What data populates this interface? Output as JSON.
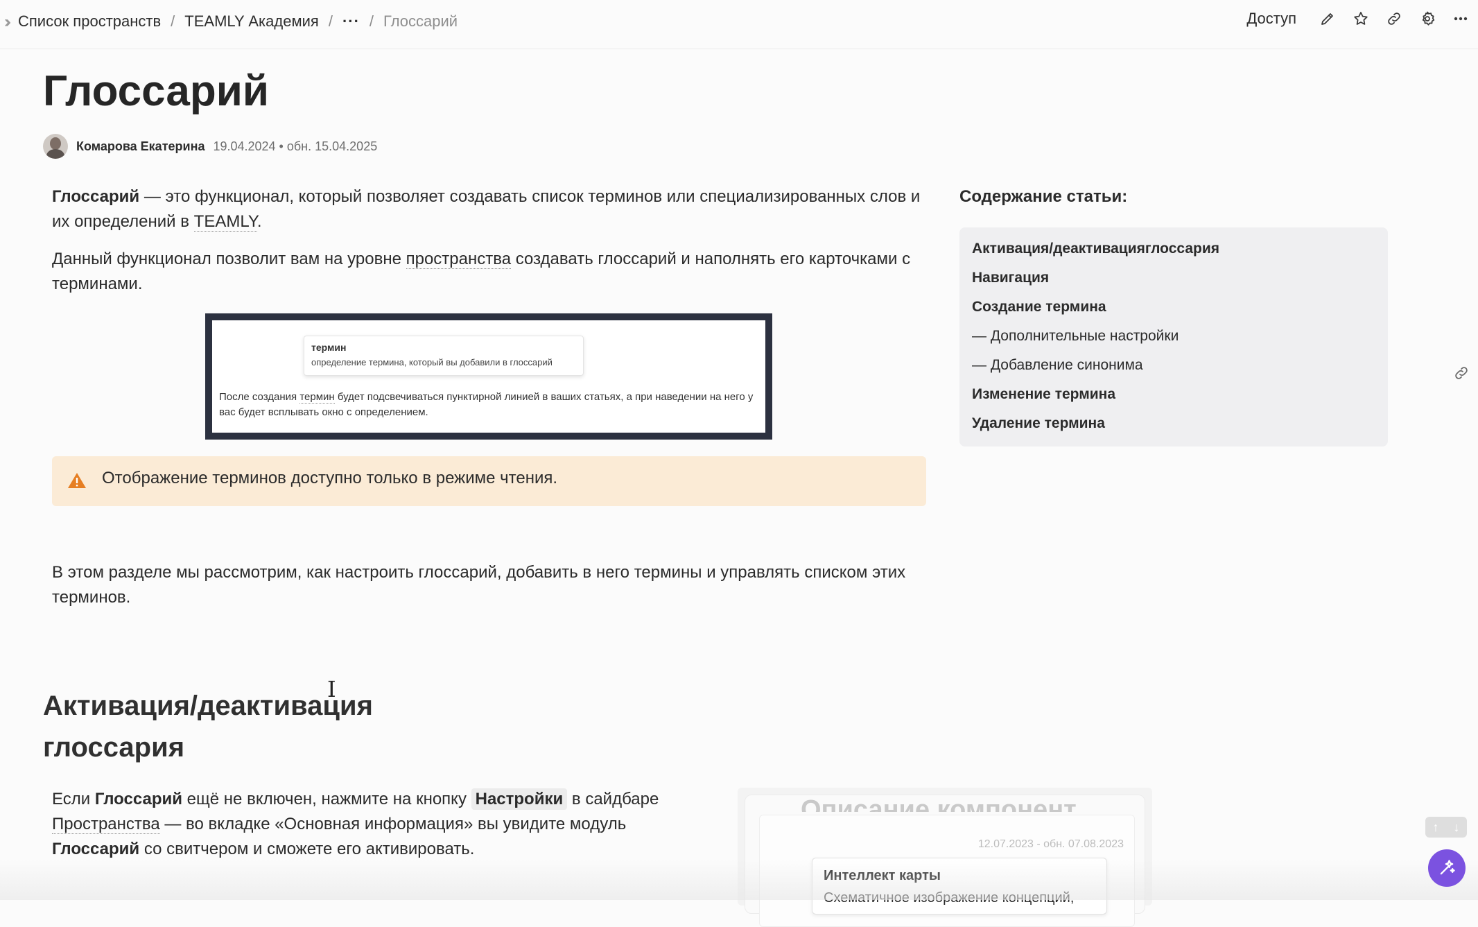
{
  "breadcrumb": {
    "spaces": "Список пространств",
    "sep": "/",
    "space": "TEAMLY Академия",
    "more": "···",
    "current": "Глоссарий"
  },
  "toolbar": {
    "access_label": "Доступ",
    "icons": [
      "pencil-icon",
      "star-icon",
      "link-icon",
      "gear-icon",
      "more-icon"
    ]
  },
  "article": {
    "title": "Глоссарий",
    "author": "Комарова Екатерина",
    "dates": "19.04.2024 • обн. 15.04.2025",
    "p1": {
      "bold": "Глоссарий",
      "text_a": " — это функционал, который позволяет создавать список терминов или специализированных слов и их определений в ",
      "link": "TEAMLY",
      "text_b": "."
    },
    "p2": {
      "text_a": "Данный функционал позволит вам на уровне ",
      "link": "пространства",
      "text_b": " создавать глоссарий и наполнять его карточками с терминами."
    },
    "screenshot": {
      "term": "термин",
      "definition": "определение термина, который вы добавили в глоссарий",
      "text_a": "После создания ",
      "term_inline": "термин",
      "text_b": " будет подсвечиваться пунктирной линией в ваших статьях, а при наведении на него у вас будет всплывать окно с определением."
    },
    "callout": "Отображение терминов доступно только в режиме чтения.",
    "p3": "В этом разделе мы рассмотрим, как настроить глоссарий, добавить в него термины и управлять списком этих терминов.",
    "section_heading": "Активация/деактивация глоссария",
    "p4": {
      "a": "Если ",
      "b": "Глоссарий",
      "c": " ещё не включен, нажмите на кнопку ",
      "chip": "Настройки",
      "d": " в сайдбаре ",
      "link": "Пространства",
      "e": " — во вкладке «Основная информация» вы увидите модуль ",
      "f": "Глоссарий",
      "g": " со свитчером и сможете его активировать."
    },
    "preview": {
      "faded_title": "Описание компонент",
      "dates": "12.07.2023 - обн. 07.08.2023",
      "card_title": "Интеллект карты",
      "card_desc": "Схематичное изображение концепций,"
    }
  },
  "toc": {
    "title": "Содержание статьи:",
    "items": [
      "Активация/деактивацияглоссария",
      "Навигация",
      "Создание термина",
      "Дополнительные настройки",
      "Добавление синонима",
      "Изменение термина",
      "Удаление термина"
    ]
  },
  "scroll": {
    "up": "↑",
    "down": "↓"
  },
  "colors": {
    "accent": "#7b52e0",
    "callout_bg": "#fbebd6",
    "warning": "#e67e22"
  }
}
